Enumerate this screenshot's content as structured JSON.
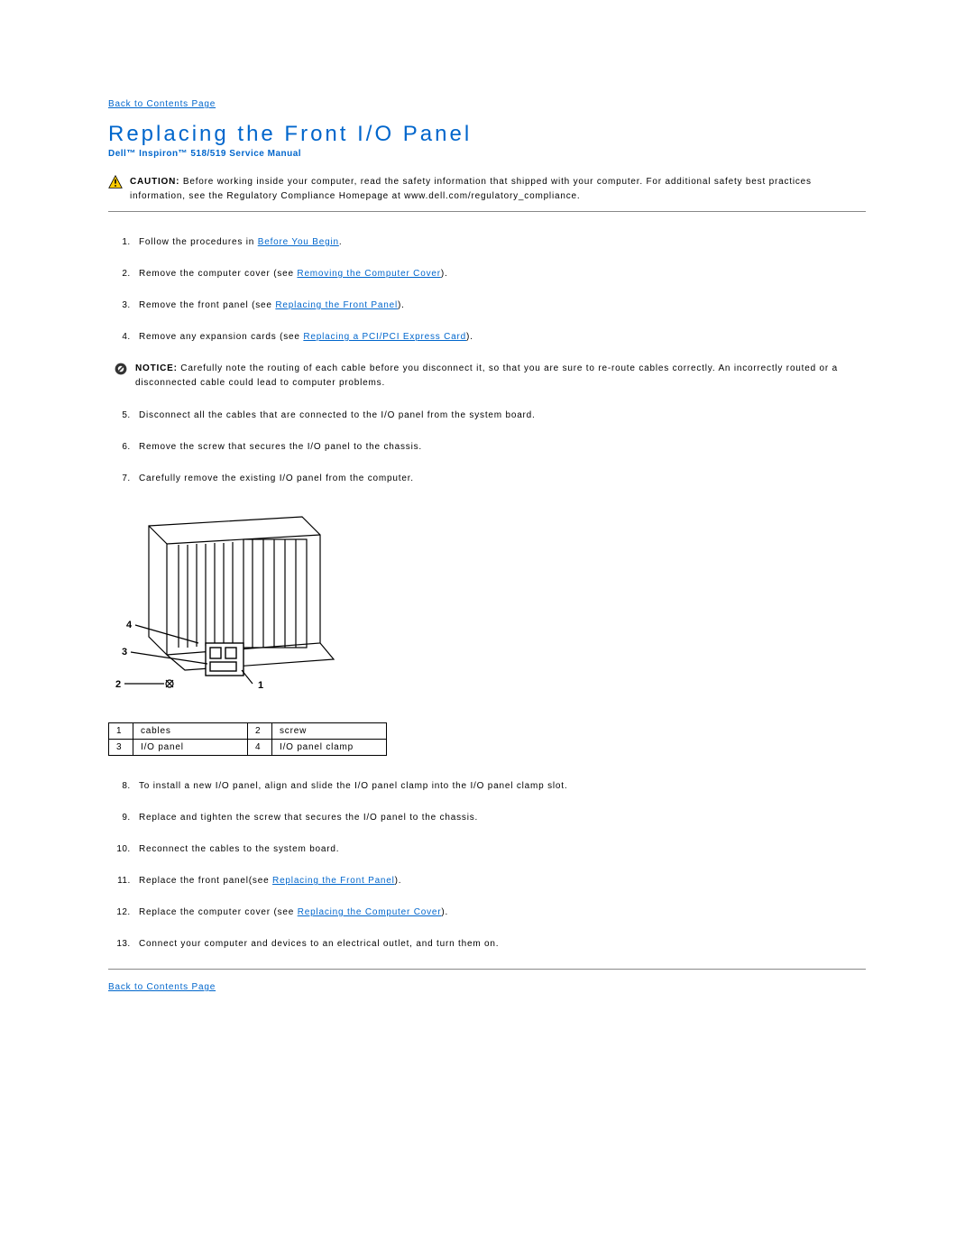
{
  "nav": {
    "back_top": "Back to Contents Page",
    "back_bottom": "Back to Contents Page"
  },
  "header": {
    "title": "Replacing the Front I/O Panel",
    "subtitle": "Dell™ Inspiron™ 518/519 Service Manual"
  },
  "caution": {
    "label": "CAUTION:",
    "text": " Before working inside your computer, read the safety information that shipped with your computer. For additional safety best practices information, see the Regulatory Compliance Homepage at www.dell.com/regulatory_compliance."
  },
  "notice": {
    "label": "NOTICE:",
    "text": " Carefully note the routing of each cable before you disconnect it, so that you are sure to re-route cables correctly. An incorrectly routed or a disconnected cable could lead to computer problems."
  },
  "steps": {
    "s1a": "Follow the procedures in ",
    "s1link": "Before You Begin",
    "s1b": ".",
    "s2a": "Remove the computer cover (see ",
    "s2link": "Removing the Computer Cover",
    "s2b": ").",
    "s3a": "Remove the front panel (see ",
    "s3link": "Replacing the Front Panel",
    "s3b": ").",
    "s4a": "Remove any expansion cards (see ",
    "s4link": "Replacing a PCI/PCI Express Card",
    "s4b": ").",
    "s5": "Disconnect all the cables that are connected to the I/O panel from the system board.",
    "s6": "Remove the screw that secures the I/O panel to the chassis.",
    "s7": "Carefully remove the existing I/O panel from the computer.",
    "s8": "To install a new I/O panel, align and slide the I/O panel clamp into the I/O panel clamp slot.",
    "s9": "Replace and tighten the screw that secures the I/O panel to the chassis.",
    "s10": "Reconnect the cables to the system board.",
    "s11a": "Replace the front panel(see ",
    "s11link": "Replacing the Front Panel",
    "s11b": ").",
    "s12a": "Replace the computer cover (see ",
    "s12link": "Replacing the Computer Cover",
    "s12b": ").",
    "s13": "Connect your computer and devices to an electrical outlet, and turn them on."
  },
  "legend": {
    "n1": "1",
    "l1": "cables",
    "n2": "2",
    "l2": "screw",
    "n3": "3",
    "l3": "I/O panel",
    "n4": "4",
    "l4": "I/O panel clamp"
  },
  "diagram_callouts": {
    "c1": "1",
    "c2": "2",
    "c3": "3",
    "c4": "4"
  }
}
